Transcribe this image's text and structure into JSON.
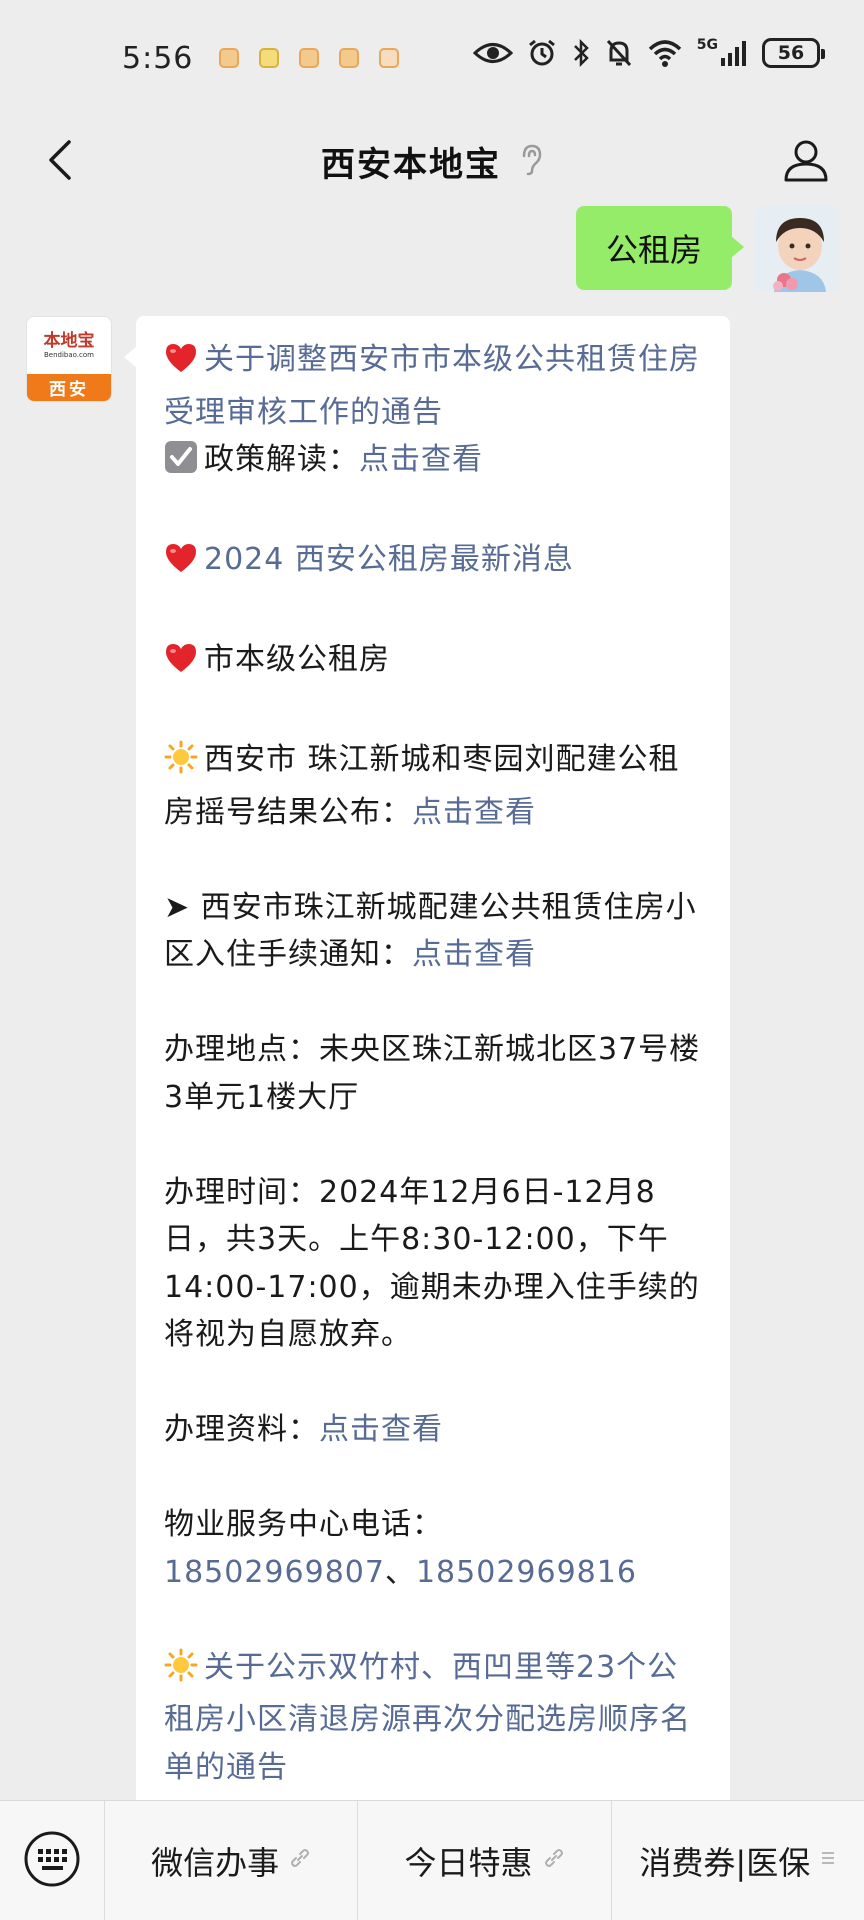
{
  "status_bar": {
    "time": "5:56",
    "network": "5G",
    "battery": "56"
  },
  "header": {
    "title": "西安本地宝"
  },
  "messages": {
    "outgoing": {
      "text": "公租房"
    },
    "incoming": {
      "avatar_logo_cn": "本地宝",
      "avatar_logo_en": "Bendibao.com",
      "avatar_city": "西安",
      "p1_link": "关于调整西安市市本级公共租赁住房受理审核工作的通告",
      "p1_label": "政策解读：",
      "p1_action": "点击查看",
      "p2_link": "2024 西安公租房最新消息",
      "p3_text": "市本级公租房",
      "p4_text": "西安市 珠江新城和枣园刘配建公租房摇号结果公布：",
      "p4_action": "点击查看",
      "p5_text": "➤ 西安市珠江新城配建公共租赁住房小区入住手续通知：",
      "p5_action": "点击查看",
      "p6_text": "办理地点：未央区珠江新城北区37号楼3单元1楼大厅",
      "p7_text": "办理时间：2024年12月6日-12月8日，共3天。上午8:30-12:00，下午14:00-17:00，逾期未办理入住手续的将视为自愿放弃。",
      "p8_label": "办理资料：",
      "p8_action": "点击查看",
      "p9_label": "物业服务中心电话：",
      "p9_phone1": "18502969807",
      "p9_sep": "、",
      "p9_phone2": "18502969816",
      "p10_link": "关于公示双竹村、西凹里等23个公租房小区清退房源再次分配选房顺序名单的通告"
    }
  },
  "bottom_menu": {
    "items": [
      {
        "label": "微信办事"
      },
      {
        "label": "今日特惠"
      },
      {
        "label": "消费券|医保"
      }
    ]
  },
  "colors": {
    "chat_bg": "#ededed",
    "outgoing_bubble": "#95ec69",
    "link": "#576b95"
  }
}
